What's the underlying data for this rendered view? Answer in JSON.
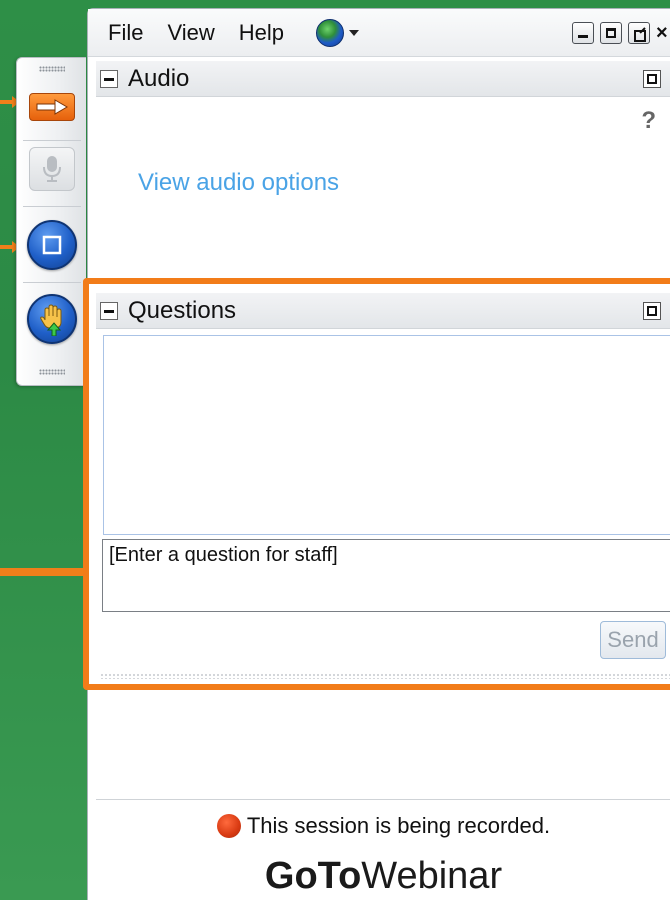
{
  "menubar": {
    "items": [
      "File",
      "View",
      "Help"
    ],
    "globe_icon": "globe-icon"
  },
  "audio": {
    "title": "Audio",
    "help_label": "?",
    "link_label": "View audio options"
  },
  "questions": {
    "title": "Questions",
    "input_placeholder": "[Enter a question for staff]",
    "send_label": "Send"
  },
  "status": {
    "recording_text": "This session is being recorded."
  },
  "brand": {
    "bold": "GoTo",
    "light": "Webinar"
  },
  "colors": {
    "background_green": "#2e8f47",
    "highlight_orange": "#f27c19",
    "link_blue": "#4aa3e6",
    "record_red": "#d83a12"
  }
}
